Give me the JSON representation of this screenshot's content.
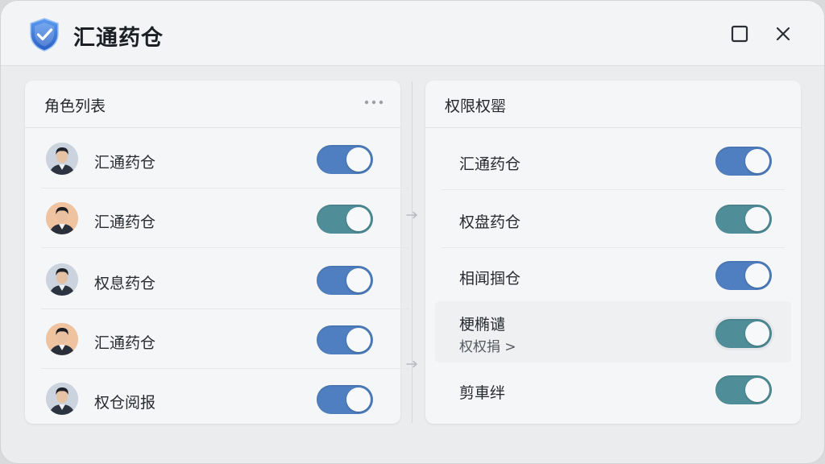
{
  "app": {
    "title": "汇通药仓",
    "icon": "shield-check-icon"
  },
  "window_controls": {
    "maximize_icon": "maximize-icon",
    "close_icon": "close-icon"
  },
  "roles_panel": {
    "title": "角色列表",
    "more_icon": "more-horizontal-icon",
    "items": [
      {
        "label": "汇通药仓",
        "avatar": "avatar-male-gray",
        "enabled": true
      },
      {
        "label": "汇通药仓",
        "avatar": "avatar-male-peach",
        "enabled": true
      },
      {
        "label": "权息药仓",
        "avatar": "avatar-male-gray",
        "enabled": true
      },
      {
        "label": "汇通药仓",
        "avatar": "avatar-male-peach",
        "enabled": true
      },
      {
        "label": "权仓阅报",
        "avatar": "avatar-male-gray",
        "enabled": true
      }
    ]
  },
  "permissions_panel": {
    "title": "权限权罂",
    "items": [
      {
        "label": "汇通药仓",
        "enabled": true
      },
      {
        "label": "权盘药仓",
        "enabled": true
      },
      {
        "label": "相闻掴仓",
        "enabled": true
      },
      {
        "label": "梗椭谴",
        "sublabel": "权权捐 >",
        "enabled": true
      },
      {
        "label": "剪車绊",
        "enabled": true
      }
    ]
  },
  "colors": {
    "toggle_blue": "#4f7fc0",
    "toggle_teal": "#4f8e98",
    "shield_blue": "#3a78d8"
  }
}
